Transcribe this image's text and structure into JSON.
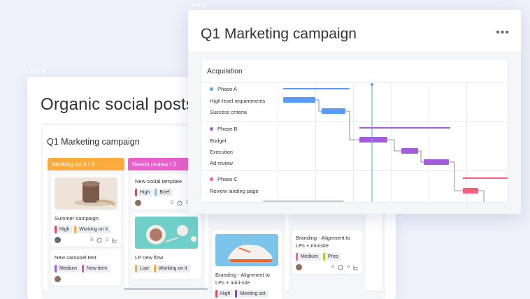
{
  "back_window": {
    "title": "Organic social posts",
    "board_title": "Q1 Marketing campaign",
    "columns": [
      {
        "header": "Working on it / 2",
        "color": "#fdab3d",
        "cards": [
          {
            "title": "Summer campaign",
            "tags": [
              {
                "label": "High",
                "color": "#e2445c"
              },
              {
                "label": "Working on it",
                "color": "#fdab3d"
              }
            ],
            "comments": "0",
            "subitems": "0"
          },
          {
            "title": "New carousel test",
            "tags": [
              {
                "label": "Medium",
                "color": "#a25ddc"
              },
              {
                "label": "New item",
                "color": "#c957d6"
              }
            ]
          }
        ]
      },
      {
        "header": "Needs review / 2",
        "color": "#e95fcb",
        "cards": [
          {
            "title": "New social template",
            "tags": [
              {
                "label": "High",
                "color": "#e2445c"
              },
              {
                "label": "Brief",
                "color": "#66ccff"
              }
            ],
            "comments": "0",
            "subitems": "0"
          },
          {
            "title": "LP new flow",
            "tags": [
              {
                "label": "Low",
                "color": "#fdab3d"
              },
              {
                "label": "Working on it",
                "color": "#fdab3d"
              }
            ]
          }
        ]
      },
      {
        "header": "",
        "color": "#ffffff",
        "cards": [
          {
            "title": "Branding - Alignment to LPs + mini-site",
            "tags": [
              {
                "label": "High",
                "color": "#e2445c"
              },
              {
                "label": "Meeting set",
                "color": "#784bd1"
              }
            ]
          }
        ]
      },
      {
        "header": "",
        "color": "#ffffff",
        "cards": [
          {
            "title": "Branding - Alignment to LPs + minisite",
            "tags": [
              {
                "label": "Medium",
                "color": "#e95fcb"
              },
              {
                "label": "Prep",
                "color": "#9cd326"
              }
            ],
            "comments": "0",
            "subitems": "0"
          }
        ]
      }
    ]
  },
  "front_window": {
    "title": "Q1 Marketing campaign",
    "more_label": "•••",
    "gantt_title": "Acquisition",
    "phases": [
      {
        "label": "Phase A",
        "color": "#579bfc",
        "tasks": [
          "High-level requirements",
          "Success criteria"
        ]
      },
      {
        "label": "Phase B",
        "color": "#a25ddc",
        "tasks": [
          "Budget",
          "Execution",
          "Ad review"
        ]
      },
      {
        "label": "Phase C",
        "color": "#f65f7c",
        "tasks": [
          "Review landing page"
        ]
      }
    ]
  }
}
